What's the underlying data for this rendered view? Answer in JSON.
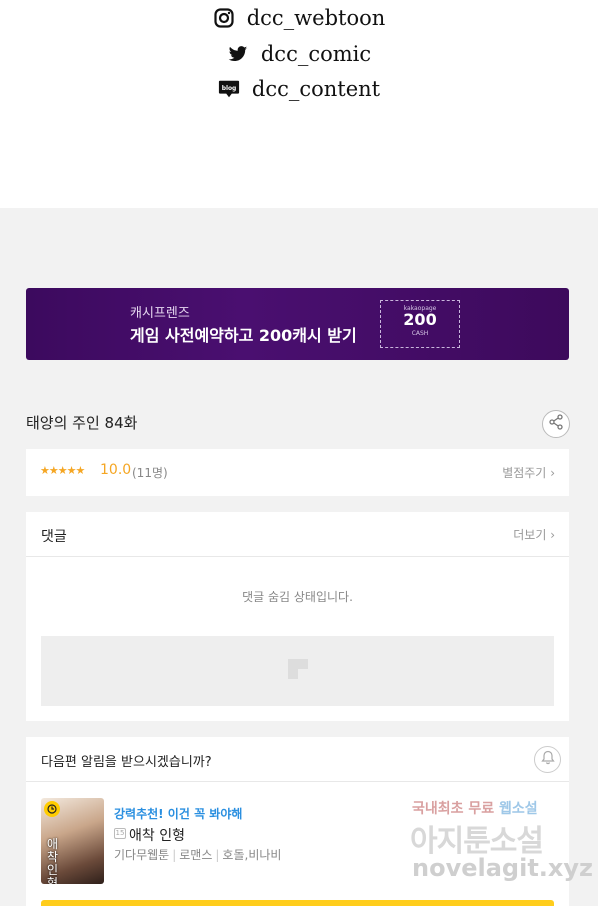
{
  "social": [
    {
      "icon": "instagram-icon",
      "handle": "dcc_webtoon"
    },
    {
      "icon": "twitter-icon",
      "handle": "dcc_comic"
    },
    {
      "icon": "blog-icon",
      "handle": "dcc_content"
    }
  ],
  "banner": {
    "subtitle": "캐시프렌즈",
    "title": "게임 사전예약하고 200캐시 받기",
    "coupon_brand": "kakaopage",
    "coupon_amount": "200",
    "coupon_unit": "CASH",
    "bg_color": "#4a0f70"
  },
  "episode": {
    "title": "태양의 주인 84화"
  },
  "rating": {
    "stars": "★★★★★",
    "score": "10.0",
    "count": "(11명)",
    "rate_link": "별점주기"
  },
  "comments": {
    "title": "댓글",
    "more": "더보기",
    "hidden_message": "댓글 숨김 상태입니다."
  },
  "notify": {
    "title": "다음편 알림을 받으시겠습니까?"
  },
  "recommendation": {
    "label": "강력추천! 이건 꼭 봐야해",
    "age_badge": "15",
    "title": "애착 인형",
    "thumb_text": "애착인형",
    "tags": [
      "기다무웹툰",
      "로맨스",
      "호돌,비나비"
    ]
  },
  "watermark": {
    "line1_a": "국내최초 무료 ",
    "line1_b": "웹소설",
    "line2": "아지툰소설",
    "line3": "novelagit.xyz"
  },
  "colors": {
    "accent_star": "#f5a623",
    "recommend_blue": "#2a8fe0",
    "button_yellow": "#ffcd1c"
  }
}
